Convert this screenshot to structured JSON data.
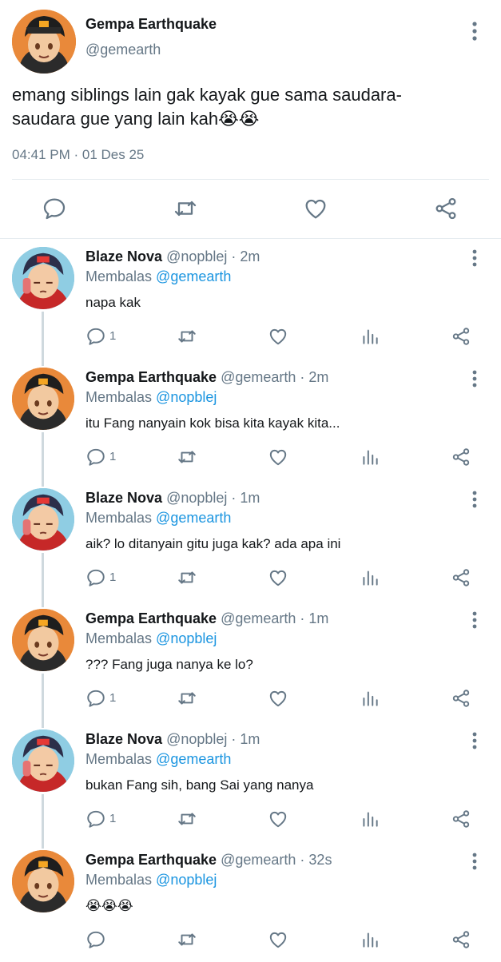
{
  "main_tweet": {
    "name": "Gempa Earthquake",
    "handle": "@gemearth",
    "text_line1": "emang siblings lain gak kayak gue sama saudara-",
    "text_line2": "saudara gue yang lain kah😭😭",
    "timestamp": "04:41 PM · 01 Des 25",
    "icons": [
      "comment-icon",
      "retweet-icon",
      "like-icon",
      "share-icon"
    ]
  },
  "colors": {
    "text": "#14171a",
    "muted": "#657786",
    "link": "#1b95e0",
    "divider": "#e6ecf0",
    "thread_line": "#cfd9de"
  },
  "replies": [
    {
      "name": "Blaze Nova",
      "handle": "@nopblej",
      "time": "· 2m",
      "replying_label": "Membalas",
      "replying_to": "@gemearth",
      "text": "napa kak",
      "reply_count": "1",
      "avatar": "blaze"
    },
    {
      "name": "Gempa Earthquake",
      "handle": "@gemearth",
      "time": "· 2m",
      "replying_label": "Membalas",
      "replying_to": "@nopblej",
      "text": "itu Fang nanyain kok bisa kita kayak kita...",
      "reply_count": "1",
      "avatar": "gempa"
    },
    {
      "name": "Blaze Nova",
      "handle": "@nopblej",
      "time": "· 1m",
      "replying_label": "Membalas",
      "replying_to": "@gemearth",
      "text": "aik? lo ditanyain gitu juga kak? ada apa ini",
      "reply_count": "1",
      "avatar": "blaze"
    },
    {
      "name": "Gempa Earthquake",
      "handle": "@gemearth",
      "time": "· 1m",
      "replying_label": "Membalas",
      "replying_to": "@nopblej",
      "text": "??? Fang juga nanya ke lo?",
      "reply_count": "1",
      "avatar": "gempa"
    },
    {
      "name": "Blaze Nova",
      "handle": "@nopblej",
      "time": "· 1m",
      "replying_label": "Membalas",
      "replying_to": "@gemearth",
      "text": "bukan Fang sih, bang Sai yang nanya",
      "reply_count": "1",
      "avatar": "blaze"
    },
    {
      "name": "Gempa Earthquake",
      "handle": "@gemearth",
      "time": "· 32s",
      "replying_label": "Membalas",
      "replying_to": "@nopblej",
      "text": "😭😭😭",
      "reply_count": "",
      "avatar": "gempa"
    }
  ]
}
